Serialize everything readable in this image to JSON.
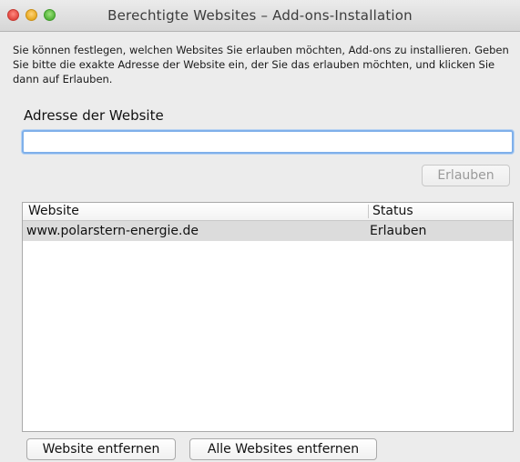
{
  "window": {
    "title": "Berechtigte Websites – Add-ons-Installation"
  },
  "description": "Sie können festlegen, welchen Websites Sie erlauben möchten, Add-ons zu installieren. Geben Sie bitte die exakte Adresse der Website ein, der Sie das erlauben möchten, und klicken Sie dann auf Erlauben.",
  "address": {
    "label": "Adresse der Website",
    "value": "",
    "placeholder": ""
  },
  "buttons": {
    "allow": "Erlauben",
    "remove": "Website entfernen",
    "remove_all": "Alle Websites entfernen"
  },
  "table": {
    "columns": [
      "Website",
      "Status"
    ],
    "rows": [
      {
        "website": "www.polarstern-energie.de",
        "status": "Erlauben"
      }
    ]
  }
}
